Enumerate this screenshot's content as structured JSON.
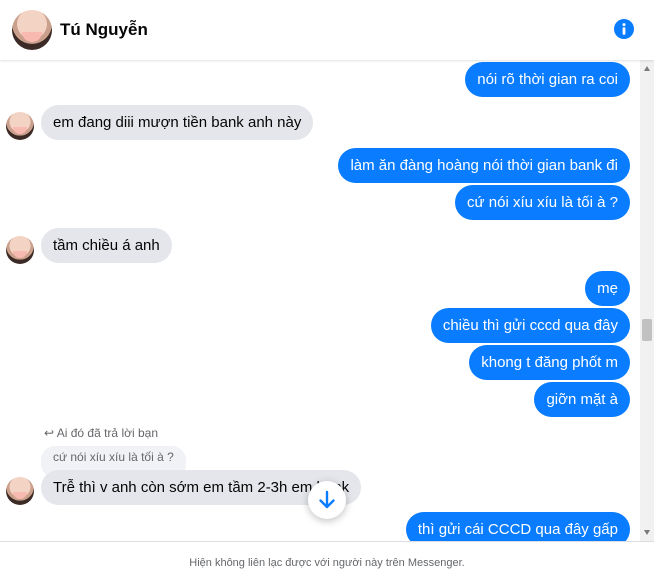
{
  "header": {
    "name": "Tú Nguyễn",
    "info_icon": "info-icon"
  },
  "messages": [
    {
      "from": "me",
      "text": "nói rõ thời gian ra coi"
    },
    {
      "from": "them",
      "text": "em đang diii mượn tiền bank anh này"
    },
    {
      "from": "me",
      "text": "làm ăn đàng hoàng nói thời gian bank đi"
    },
    {
      "from": "me",
      "text": "cứ nói xíu xíu là tối à ?"
    },
    {
      "from": "them",
      "text": "tầm chiều á anh"
    },
    {
      "from": "me",
      "text": "mẹ"
    },
    {
      "from": "me",
      "text": "chiều thì gửi cccd qua đây"
    },
    {
      "from": "me",
      "text": "khong t đăng phốt m"
    },
    {
      "from": "me",
      "text": "giỡn mặt à"
    },
    {
      "from": "them",
      "text": "Trễ thì v anh còn sớm em tầm 2-3h em bank"
    },
    {
      "from": "me",
      "text": "thì gửi cái CCCD qua đây gấp"
    }
  ],
  "reply": {
    "meta": "Ai đó đã trả lời bạn",
    "quote": "cứ nói xíu xíu là tối à ?"
  },
  "footer": {
    "notice": "Hiện không liên lạc được với người này trên Messenger."
  },
  "colors": {
    "accent": "#0a7cff",
    "incoming_bubble": "#e4e6eb"
  }
}
